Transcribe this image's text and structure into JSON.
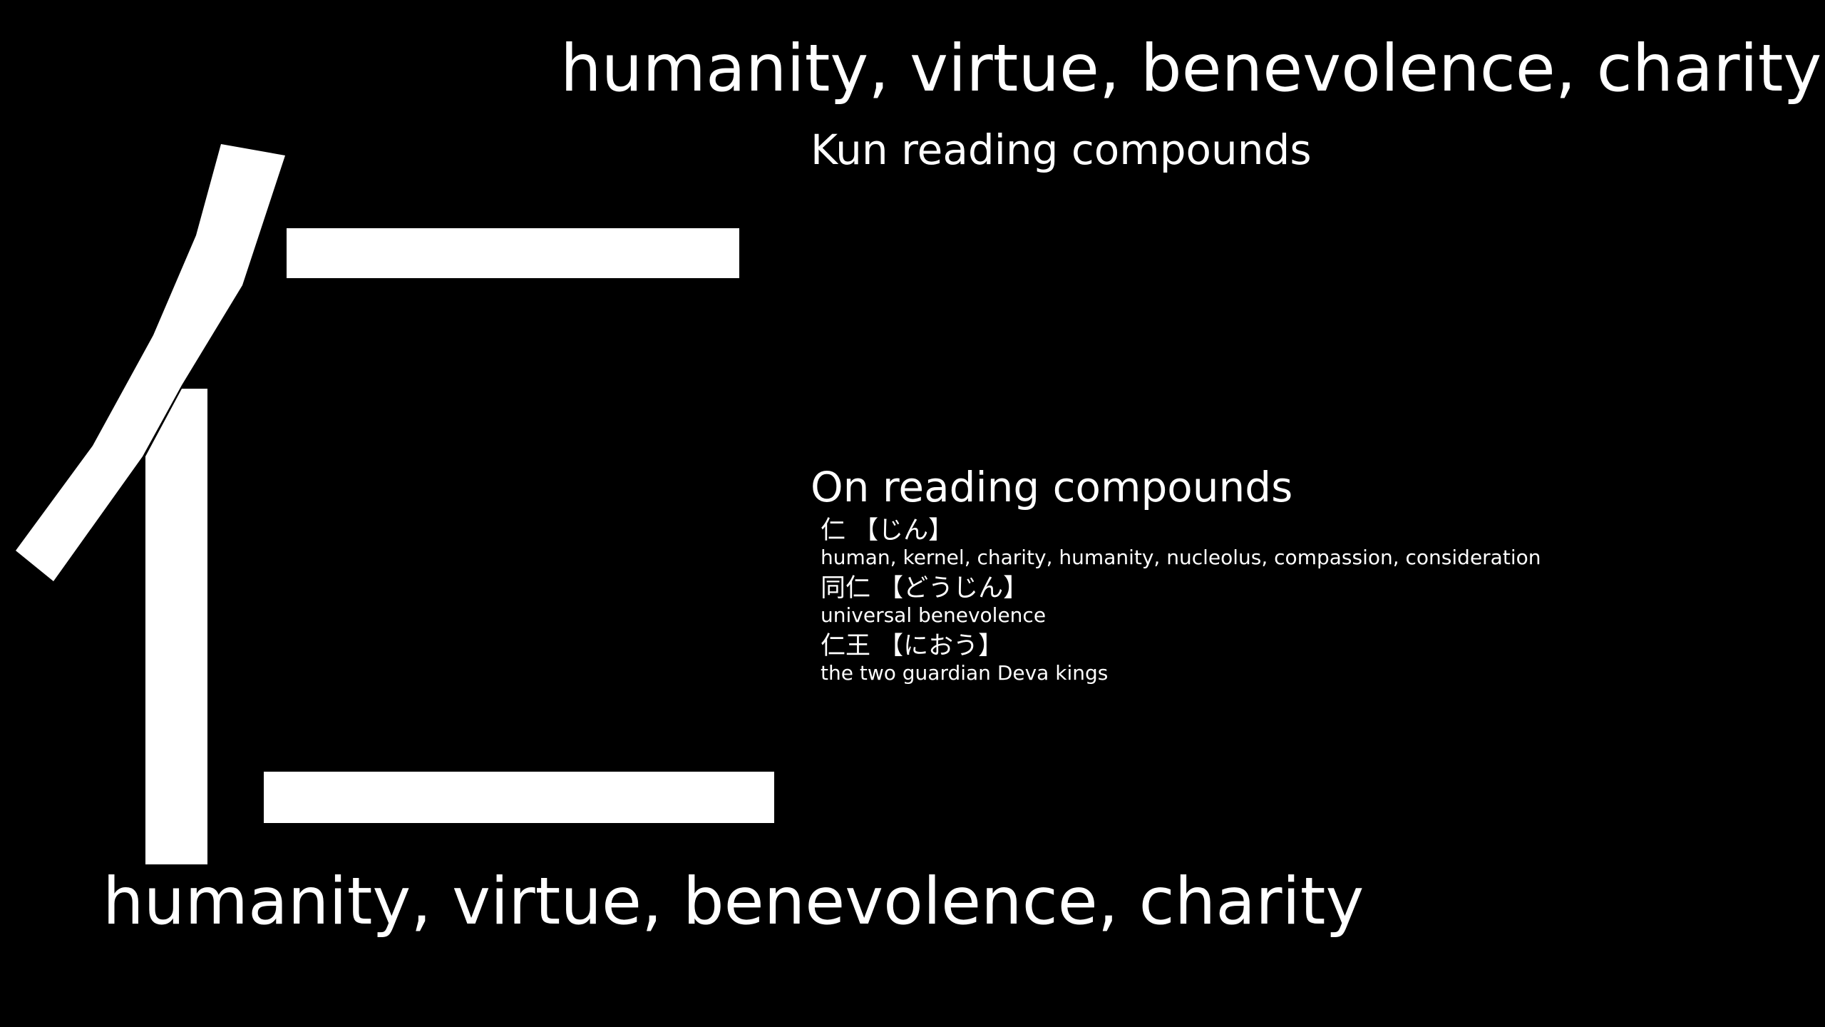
{
  "kanji": {
    "character": "仁",
    "meaning": "humanity, virtue, benevolence, charity"
  },
  "sections": {
    "kun_heading": "Kun reading compounds",
    "on_heading": "On reading compounds"
  },
  "on_compounds": [
    {
      "word": "仁 【じん】",
      "gloss": "human, kernel, charity, humanity, nucleolus, compassion, consideration"
    },
    {
      "word": "同仁 【どうじん】",
      "gloss": "universal benevolence"
    },
    {
      "word": "仁王 【におう】",
      "gloss": "the two guardian Deva kings"
    }
  ],
  "colors": {
    "background": "#000000",
    "foreground": "#ffffff"
  }
}
